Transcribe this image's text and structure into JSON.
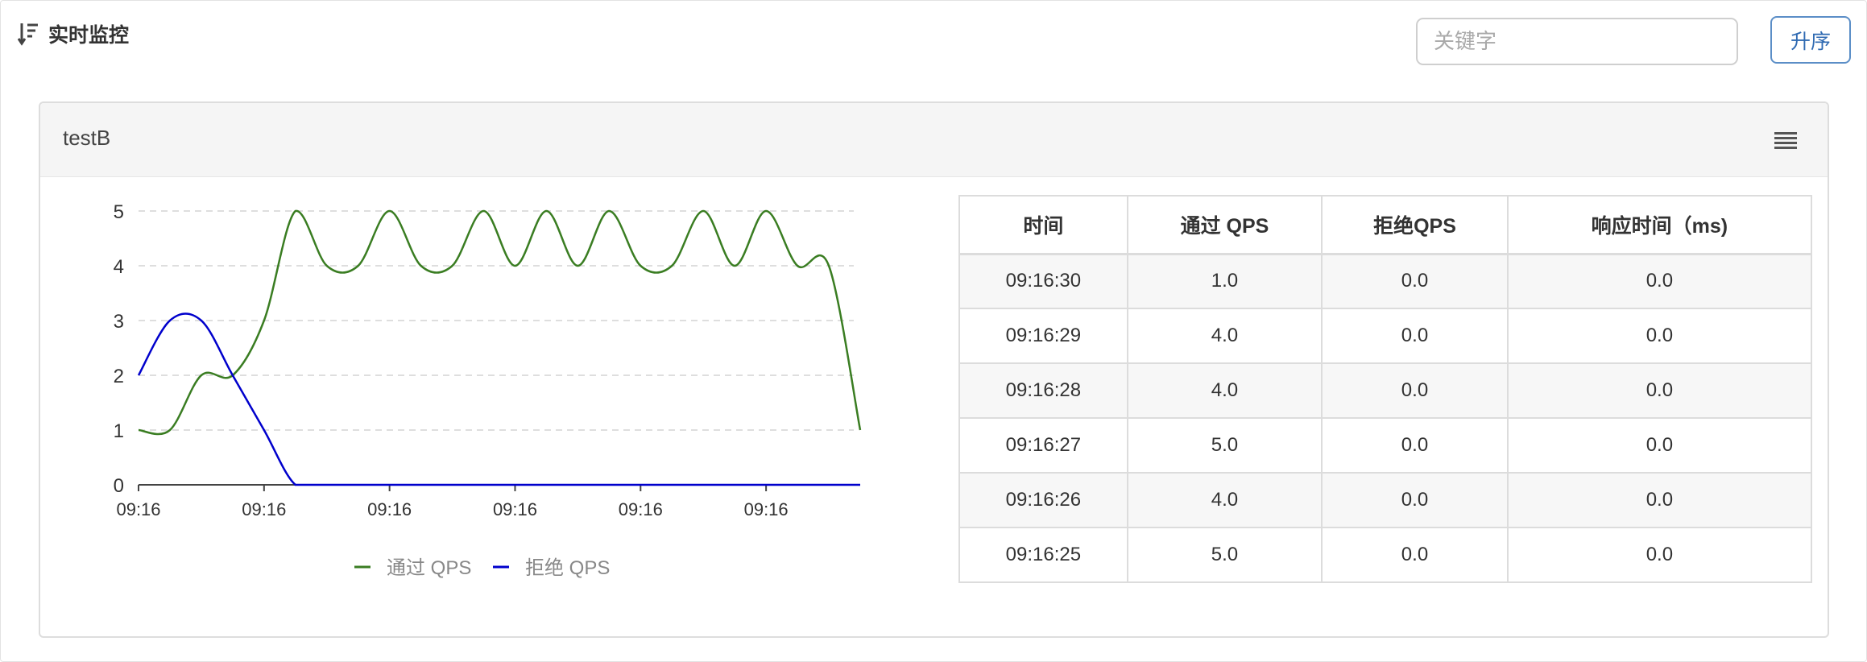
{
  "header": {
    "title": "实时监控",
    "sort_icon": "sort-descending-icon",
    "search_placeholder": "关键字",
    "search_value": "",
    "sort_button_label": "升序"
  },
  "panel": {
    "title": "testB",
    "menu_icon": "menu-lines-icon"
  },
  "chart_data": {
    "type": "line",
    "title": "",
    "xlabel": "",
    "ylabel": "",
    "ylim": [
      0,
      5
    ],
    "yticks": [
      "0",
      "1",
      "2",
      "3",
      "4",
      "5"
    ],
    "xtick_labels": [
      "09:16",
      "09:16",
      "09:16",
      "09:16",
      "09:16",
      "09:16"
    ],
    "xlim": [
      0,
      23
    ],
    "grid": true,
    "legend_position": "bottom",
    "series": [
      {
        "name": "通过 QPS",
        "color": "#3a7d22",
        "x": [
          0,
          1,
          2,
          3,
          4,
          5,
          6,
          7,
          8,
          9,
          10,
          11,
          12,
          13,
          14,
          15,
          16,
          17,
          18,
          19,
          20,
          21,
          22,
          23
        ],
        "values": [
          1,
          1,
          2,
          2,
          3,
          5,
          4,
          4,
          5,
          4,
          4,
          5,
          4,
          5,
          4,
          5,
          4,
          4,
          5,
          4,
          5,
          4,
          4,
          1
        ]
      },
      {
        "name": "拒绝 QPS",
        "color": "#0000cc",
        "x": [
          0,
          1,
          2,
          3,
          4,
          5,
          6,
          7,
          8,
          9,
          10,
          11,
          12,
          13,
          14,
          15,
          16,
          17,
          18,
          19,
          20,
          21,
          22,
          23
        ],
        "values": [
          2,
          3,
          3,
          2,
          1,
          0,
          0,
          0,
          0,
          0,
          0,
          0,
          0,
          0,
          0,
          0,
          0,
          0,
          0,
          0,
          0,
          0,
          0,
          0
        ]
      }
    ]
  },
  "table": {
    "headers": [
      "时间",
      "通过 QPS",
      "拒绝QPS",
      "响应时间（ms)"
    ],
    "rows": [
      [
        "09:16:30",
        "1.0",
        "0.0",
        "0.0"
      ],
      [
        "09:16:29",
        "4.0",
        "0.0",
        "0.0"
      ],
      [
        "09:16:28",
        "4.0",
        "0.0",
        "0.0"
      ],
      [
        "09:16:27",
        "5.0",
        "0.0",
        "0.0"
      ],
      [
        "09:16:26",
        "4.0",
        "0.0",
        "0.0"
      ],
      [
        "09:16:25",
        "5.0",
        "0.0",
        "0.0"
      ]
    ]
  },
  "colors": {
    "pass": "#3a7d22",
    "block": "#0000cc",
    "button_text": "#2f6ab2"
  }
}
